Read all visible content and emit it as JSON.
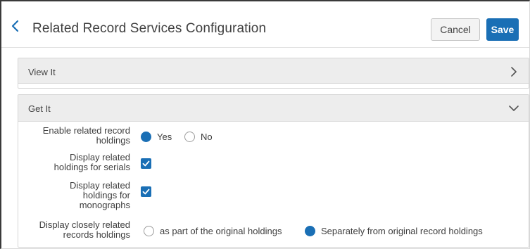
{
  "header": {
    "title": "Related Record Services Configuration",
    "cancel_label": "Cancel",
    "save_label": "Save",
    "back_icon": "chevron-left-icon"
  },
  "sections": [
    {
      "label": "View It",
      "state": "collapsed",
      "icon": "chevron-right-icon"
    },
    {
      "label": "Get It",
      "state": "expanded",
      "icon": "chevron-down-icon",
      "fields": {
        "enable_related": {
          "label_line1": "Enable related record",
          "label_line2": "holdings",
          "options": [
            "Yes",
            "No"
          ],
          "selected": "Yes"
        },
        "serials": {
          "label_line1": "Display related",
          "label_line2": "holdings for serials",
          "checked": true
        },
        "monographs": {
          "label_line1": "Display related",
          "label_line2": "holdings for",
          "label_line3": "monographs",
          "checked": true
        },
        "closely_related": {
          "label_line1": "Display closely related",
          "label_line2": "records holdings",
          "options": [
            "as part of the original holdings",
            "Separately from original record holdings"
          ],
          "selected": "Separately from original record holdings"
        }
      }
    }
  ],
  "colors": {
    "accent": "#1a6fb5",
    "section_header_bg": "#ededed",
    "cancel_bg": "#f3f3f3"
  }
}
